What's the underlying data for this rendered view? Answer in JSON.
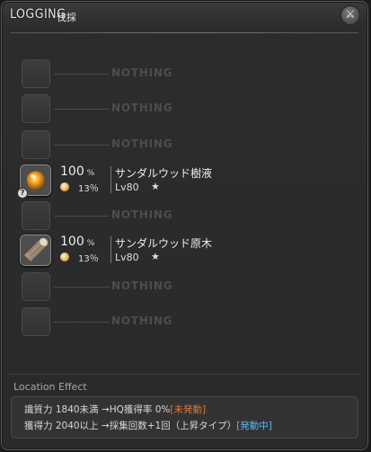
{
  "window": {
    "title_en": "LOGGING",
    "title_jp": "伐採",
    "close_label": "⚔"
  },
  "slots": [
    {
      "type": "empty",
      "label": "NOTHING"
    },
    {
      "type": "empty",
      "label": "NOTHING"
    },
    {
      "type": "empty",
      "label": "NOTHING"
    },
    {
      "type": "item",
      "icon": "tree-sap-icon",
      "hidden": true,
      "hidden_mark": "?",
      "chance": "100",
      "percent": "%",
      "hq_chance": "13％",
      "name": "サンダルウッド樹液",
      "level": "Lv80",
      "star": "★"
    },
    {
      "type": "empty",
      "label": "NOTHING"
    },
    {
      "type": "item",
      "icon": "log-icon",
      "hidden": false,
      "chance": "100",
      "percent": "%",
      "hq_chance": "13％",
      "name": "サンダルウッド原木",
      "level": "Lv80",
      "star": "★"
    },
    {
      "type": "empty",
      "label": "NOTHING"
    },
    {
      "type": "empty",
      "label": "NOTHING"
    }
  ],
  "location_effect": {
    "label": "Location Effect",
    "lines": [
      {
        "text": "識質力 1840未満 →HQ獲得率 0%",
        "status": "[未発動]",
        "active": false
      },
      {
        "text": "獲得力 2040以上 →採集回数+1回（上昇タイプ）",
        "status": "[発動中]",
        "active": true
      }
    ]
  },
  "colors": {
    "status_inactive": "#e0763a",
    "status_active": "#5ab8f0"
  }
}
